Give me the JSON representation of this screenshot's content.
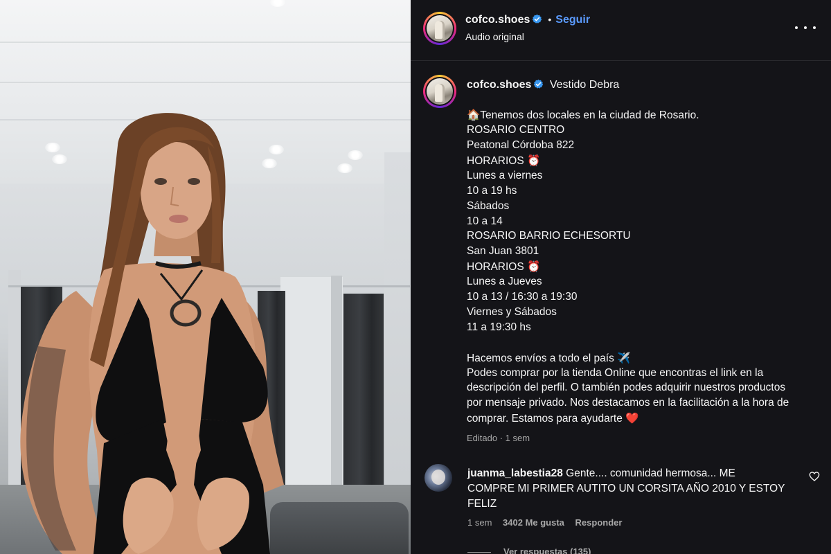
{
  "header": {
    "username": "cofco.shoes",
    "separator": "•",
    "follow_label": "Seguir",
    "audio_label": "Audio original"
  },
  "caption": {
    "username": "cofco.shoes",
    "title": "Vestido Debra",
    "lines": [
      "🏠Tenemos dos locales en la ciudad de Rosario.",
      "ROSARIO CENTRO",
      "Peatonal Córdoba 822",
      "HORARIOS ⏰",
      "Lunes a viernes",
      "10 a 19 hs",
      "Sábados",
      "10 a 14",
      "ROSARIO BARRIO ECHESORTU",
      "San Juan 3801",
      "HORARIOS ⏰",
      "Lunes a Jueves",
      "10 a 13 / 16:30 a 19:30",
      "Viernes y Sábados",
      "11 a 19:30 hs",
      "",
      "Hacemos envíos a todo el país ✈️",
      "Podes comprar por la tienda Online que encontras el link en la",
      "descripción del perfil. O también podes adquirir nuestros productos",
      "por mensaje privado. Nos destacamos en la facilitación a la hora de",
      "comprar. Estamos para ayudarte ❤️"
    ],
    "meta": "Editado · 1 sem"
  },
  "comment": {
    "username": "juanma_labestia28",
    "text_line1": "Gente.... comunidad hermosa... ME",
    "text_line2": "COMPRE MI PRIMER AUTITO UN CORSITA AÑO 2010 Y ESTOY",
    "text_line3": "FELIZ",
    "time": "1 sem",
    "likes": "3402 Me gusta",
    "reply_label": "Responder",
    "view_replies": "Ver respuestas (135)"
  },
  "icons": {
    "verified": "verified-badge-icon",
    "more": "more-options-icon",
    "heart": "heart-icon"
  },
  "colors": {
    "panel_bg": "#141418",
    "follow": "#5b9bff",
    "verified": "#3897f0",
    "muted": "#a8a8a8"
  }
}
